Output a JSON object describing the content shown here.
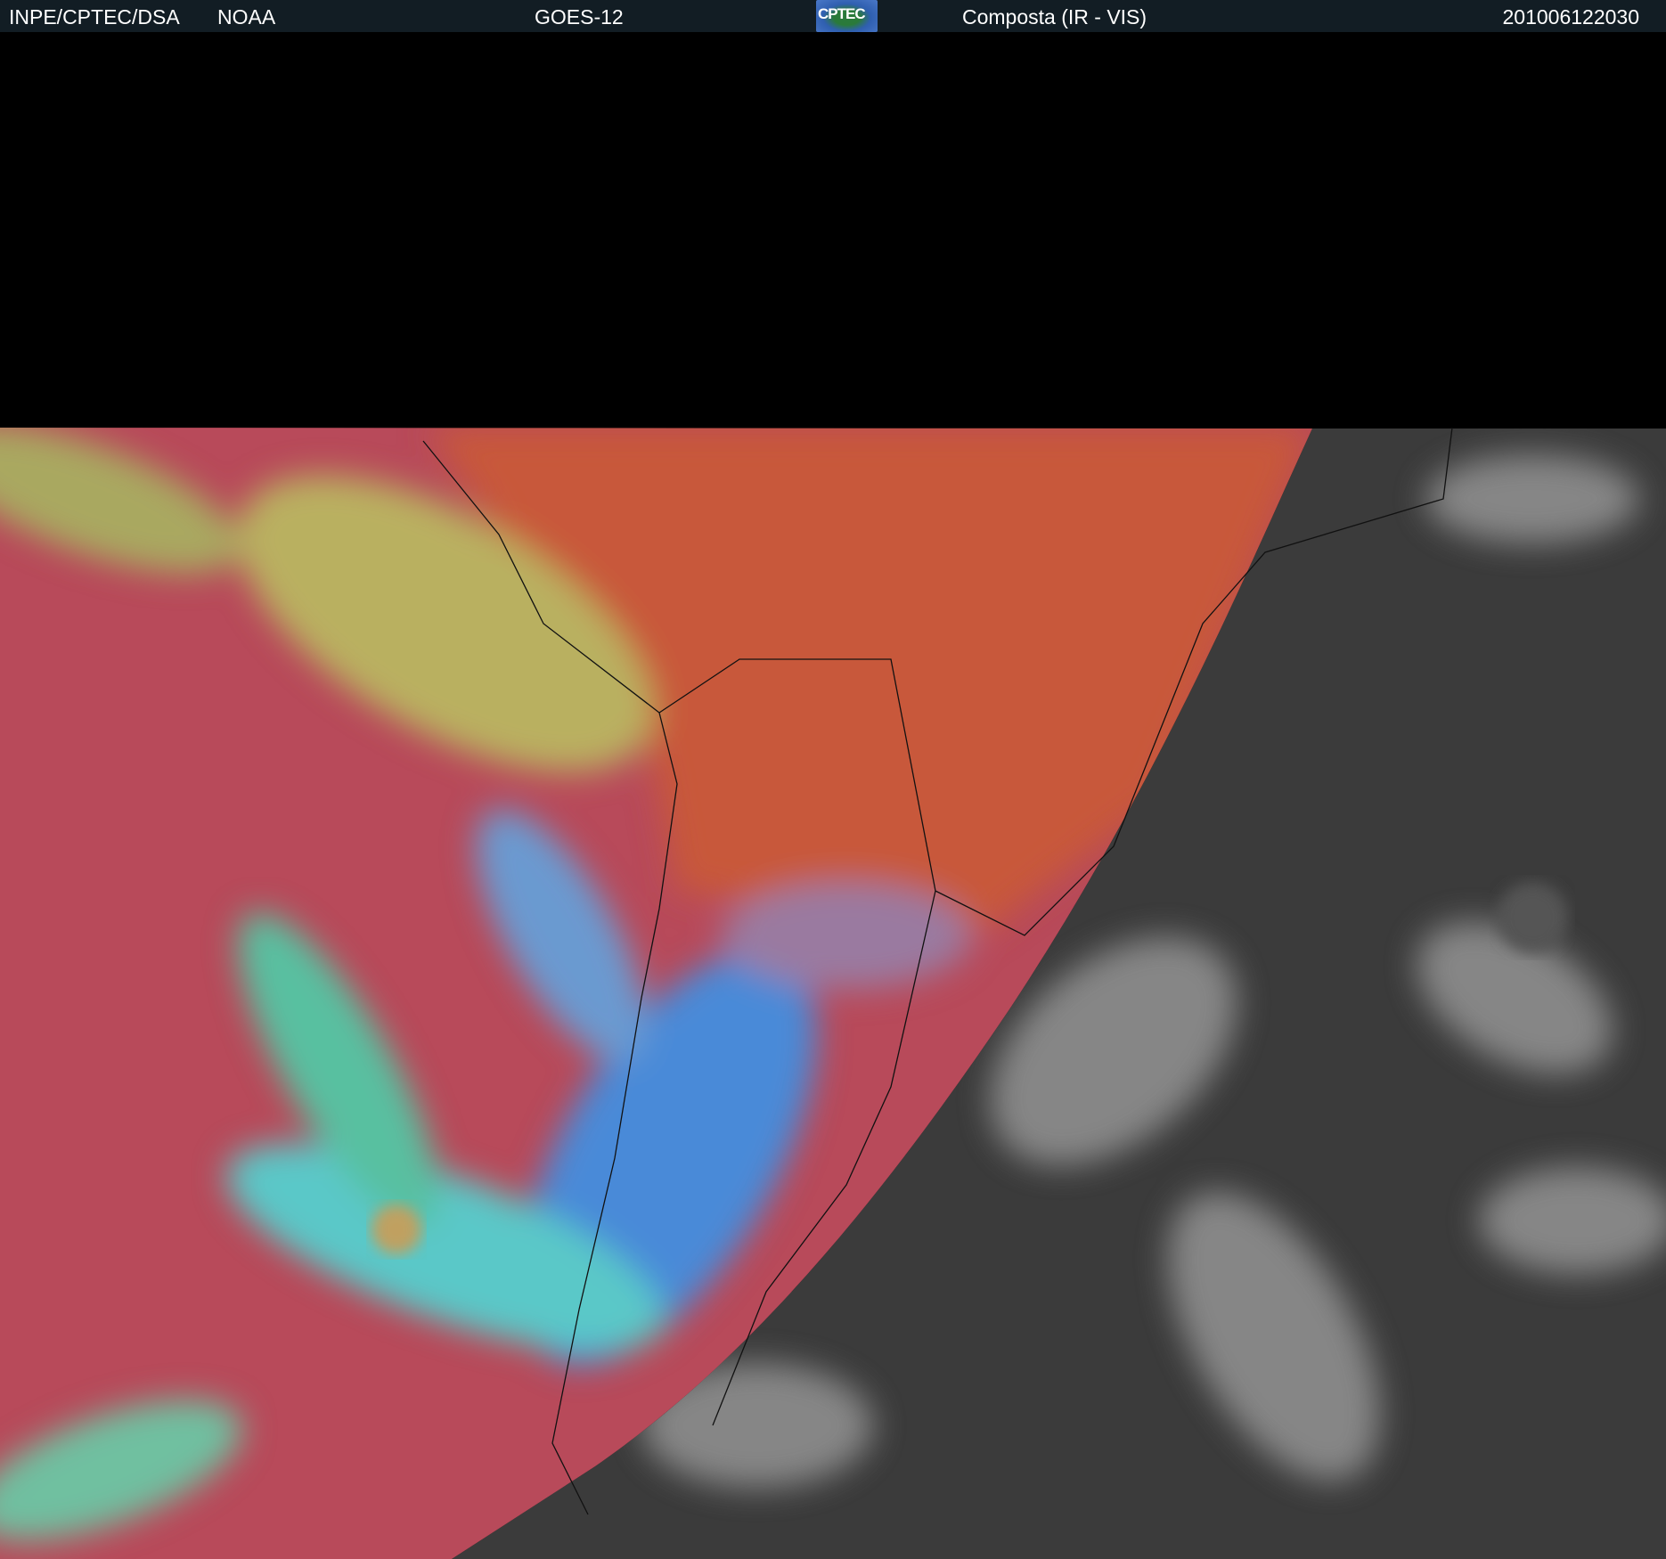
{
  "header": {
    "agency": "INPE/CPTEC/DSA",
    "partner": "NOAA",
    "satellite": "GOES-12",
    "logo_text": "CPTEC",
    "product": "Composta (IR - VIS)",
    "timestamp": "201006122030"
  },
  "colors": {
    "header_bg": "#121d24",
    "ir_ocean": "#b84a5a",
    "ir_land": "#c8583a",
    "vis_bg": "#3b3b3b"
  }
}
